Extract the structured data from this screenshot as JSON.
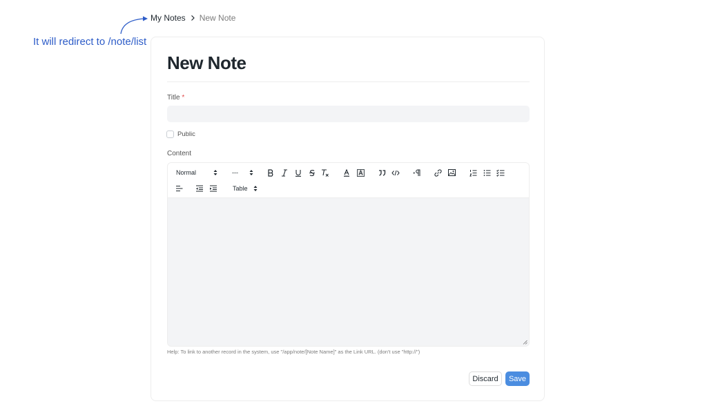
{
  "annotation": {
    "text": "It will redirect to /note/list"
  },
  "breadcrumb": {
    "parent": "My Notes",
    "current": "New Note"
  },
  "page": {
    "title": "New Note"
  },
  "form": {
    "title_label": "Title",
    "required_mark": "*",
    "title_value": "",
    "public_label": "Public",
    "public_checked": false,
    "content_label": "Content"
  },
  "toolbar": {
    "style_select": "Normal",
    "size_select": "---",
    "table_select": "Table",
    "icons": [
      "bold-icon",
      "italic-icon",
      "underline-icon",
      "strikethrough-icon",
      "clear-format-icon",
      "text-color-icon",
      "background-color-icon",
      "blockquote-icon",
      "code-icon",
      "paragraph-direction-icon",
      "link-icon",
      "image-icon",
      "ordered-list-icon",
      "bullet-list-icon",
      "checklist-icon",
      "align-left-icon",
      "outdent-icon",
      "indent-icon"
    ]
  },
  "help": {
    "text": "Help: To link to another record in the system, use \"/app/note/[Note Name]\" as the Link URL. (don't use \"http://\")"
  },
  "actions": {
    "discard": "Discard",
    "save": "Save"
  },
  "colors": {
    "accent": "#4b8de0",
    "annotation": "#2d5cc8",
    "required": "#e24c4c"
  }
}
